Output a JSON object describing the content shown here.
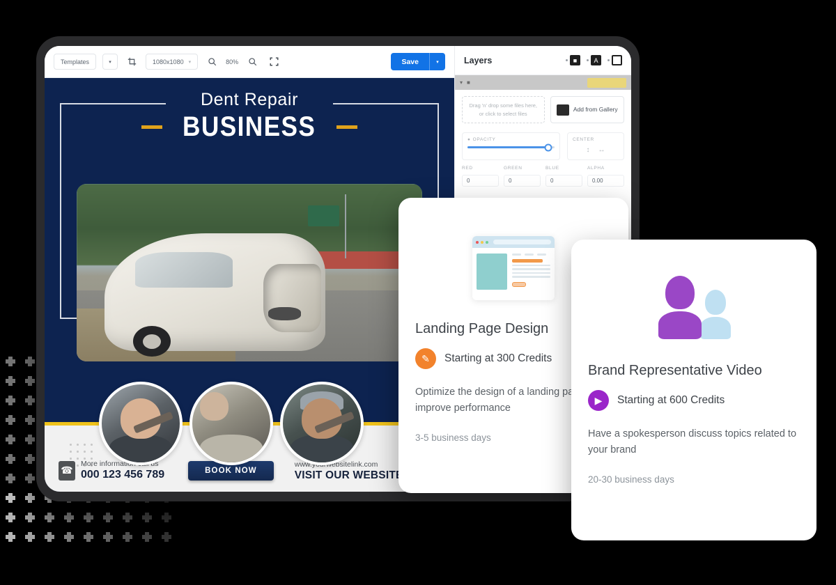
{
  "editor": {
    "toolbar": {
      "templates_label": "Templates",
      "templates_caret": "▾",
      "crop_icon": "crop-icon",
      "canvas_size": "1080x1080",
      "canvas_size_caret": "▾",
      "zoom_out_icon": "zoom-out-icon",
      "zoom_level": "80%",
      "zoom_in_icon": "zoom-in-icon",
      "fullscreen_icon": "fullscreen-icon",
      "save_label": "Save",
      "save_caret": "▾",
      "save_color": "#1273e6"
    },
    "poster": {
      "eyebrow": "Dent Repair",
      "headline": "BUSINESS",
      "background_color": "#0d2350",
      "accent_color": "#e0a21c",
      "contact_caption": "More information call us",
      "phone": "000 123 456 789",
      "cta_label": "BOOK NOW",
      "website_url": "www.yourwebsitelink.com",
      "website_cta": "VISIT OUR WEBSITE"
    },
    "layers": {
      "title": "Layers",
      "image_tool": "image-layer-icon",
      "text_tool": "text-layer-icon",
      "shape_tool": "shape-layer-icon",
      "text_tool_glyph": "A",
      "dropzone_text": "Drag 'n' drop some files here, or click to select files",
      "gallery_label": "Add from Gallery",
      "opacity_label": "OPACITY",
      "center_label": "CENTER",
      "opacity_value": 93,
      "channels": [
        {
          "label": "RED",
          "value": "0"
        },
        {
          "label": "GREEN",
          "value": "0"
        },
        {
          "label": "BLUE",
          "value": "0"
        },
        {
          "label": "ALPHA",
          "value": "0.00"
        }
      ]
    }
  },
  "cards": [
    {
      "title": "Landing Page Design",
      "illustration": "browser-window-illustration",
      "price": "Starting at 300 Credits",
      "icon": "paintbrush-icon",
      "icon_color": "#f2822c",
      "description": "Optimize the design of a landing page to improve performance",
      "turnaround": "3-5 business days"
    },
    {
      "title": "Brand Representative Video",
      "illustration": "two-people-illustration",
      "price": "Starting at 600 Credits",
      "icon": "video-camera-icon",
      "icon_color": "#9a26c9",
      "description": "Have a spokesperson discuss topics related to your brand",
      "turnaround": "20-30 business days"
    }
  ]
}
